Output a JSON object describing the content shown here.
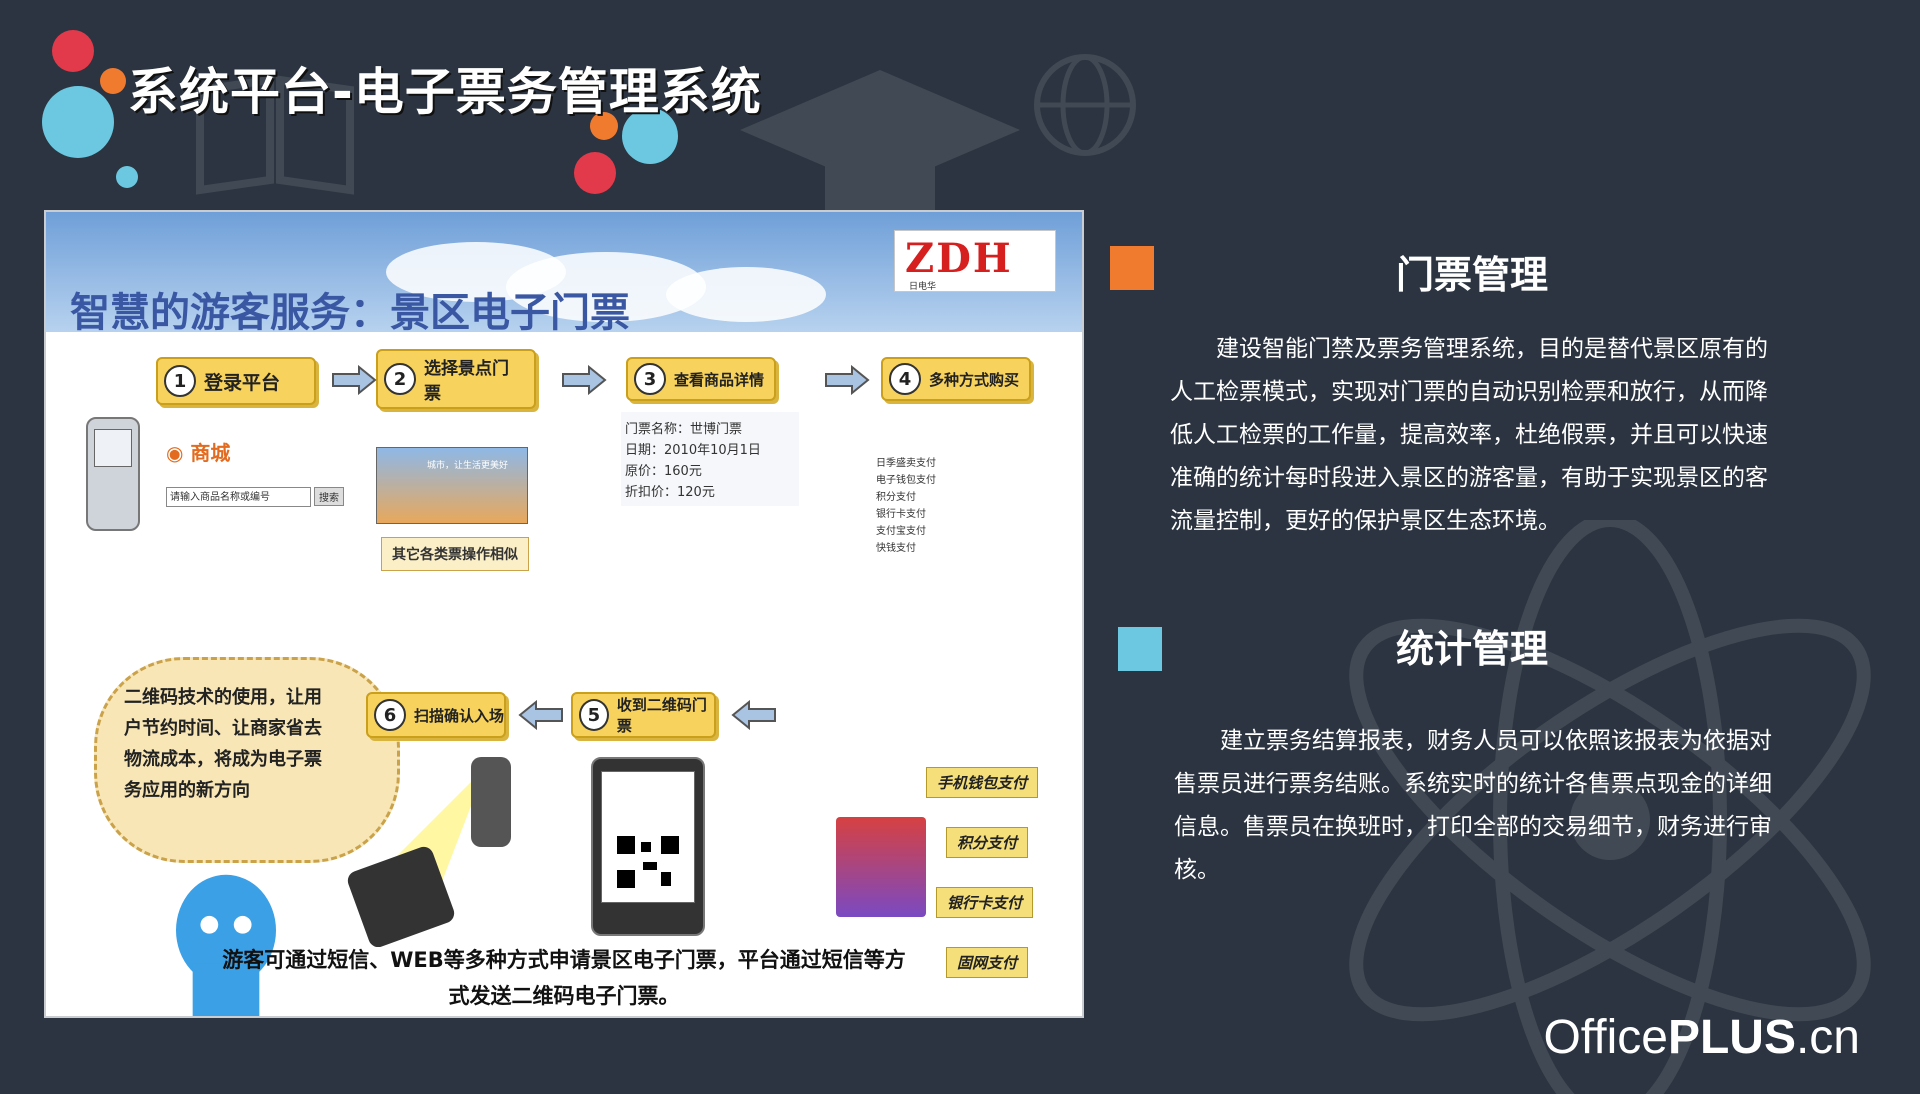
{
  "page": {
    "title": "系统平台-电子票务管理系统",
    "brand_regular": "Office",
    "brand_bold": "PLUS",
    "brand_suffix": ".cn"
  },
  "colors": {
    "background": "#2b3440",
    "accent_orange": "#f07a2e",
    "accent_blue": "#6bc8e0",
    "accent_red": "#e23a4a"
  },
  "slide": {
    "heading": "智慧的游客服务：景区电子门票",
    "logo_main": "ZDH",
    "logo_sub": "日电华",
    "steps": [
      {
        "num": "1",
        "label": "登录平台"
      },
      {
        "num": "2",
        "label": "选择景点门票"
      },
      {
        "num": "3",
        "label": "查看商品详情"
      },
      {
        "num": "4",
        "label": "多种方式购买"
      },
      {
        "num": "5",
        "label": "收到二维码门票"
      },
      {
        "num": "6",
        "label": "扫描确认入场"
      }
    ],
    "search_placeholder": "请输入商品名称或编号",
    "search_button": "搜索",
    "city_caption": "城市，让生活更美好",
    "other_tickets": "其它各类票操作相似",
    "detail": {
      "name": "门票名称：世博门票",
      "date": "日期：2010年10月1日",
      "price": "原价：160元",
      "discount": "折扣价：120元"
    },
    "pay_options": [
      "日季盛卖支付",
      "电子钱包支付",
      "积分支付",
      "银行卡支付",
      "支付宝支付",
      "快钱支付"
    ],
    "pay_methods": [
      "手机钱包支付",
      "积分支付",
      "银行卡支付",
      "固网支付"
    ],
    "bubble_text": "二维码技术的使用，让用户节约时间、让商家省去物流成本，将成为电子票务应用的新方向",
    "caption_line1": "游客可通过短信、WEB等多种方式申请景区电子门票，平台通过短信等方",
    "caption_line2": "式发送二维码电子门票。"
  },
  "section1": {
    "title": "门票管理",
    "body": "建设智能门禁及票务管理系统，目的是替代景区原有的人工检票模式，实现对门票的自动识别检票和放行，从而降低人工检票的工作量，提高效率，杜绝假票，并且可以快速准确的统计每时段进入景区的游客量，有助于实现景区的客流量控制，更好的保护景区生态环境。"
  },
  "section2": {
    "title": "统计管理",
    "body": "建立票务结算报表，财务人员可以依照该报表为依据对售票员进行票务结账。系统实时的统计各售票点现金的详细信息。售票员在换班时，打印全部的交易细节，财务进行审核。"
  }
}
